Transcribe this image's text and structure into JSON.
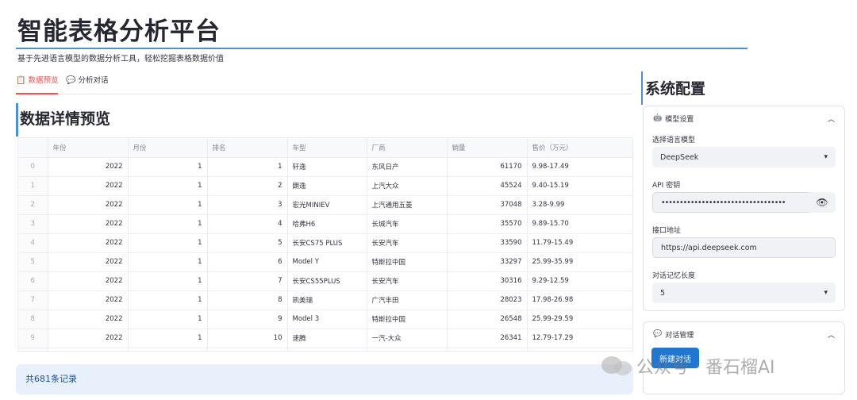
{
  "header": {
    "title": "智能表格分析平台",
    "subtitle": "基于先进语言模型的数据分析工具，轻松挖掘表格数据价值"
  },
  "tabs": [
    {
      "label": "数据预览",
      "icon": "clipboard-icon",
      "active": true
    },
    {
      "label": "分析对话",
      "icon": "chat-bubble-icon",
      "active": false
    }
  ],
  "main": {
    "section_title": "数据详情预览",
    "table": {
      "columns": [
        "",
        "年份",
        "月份",
        "排名",
        "车型",
        "厂商",
        "销量",
        "售价（万元）"
      ],
      "rows": [
        [
          "0",
          "2022",
          "1",
          "1",
          "轩逸",
          "东风日产",
          "61170",
          "9.98-17.49"
        ],
        [
          "1",
          "2022",
          "1",
          "2",
          "朗逸",
          "上汽大众",
          "45524",
          "9.40-15.19"
        ],
        [
          "2",
          "2022",
          "1",
          "3",
          "宏光MINIEV",
          "上汽通用五菱",
          "37048",
          "3.28-9.99"
        ],
        [
          "3",
          "2022",
          "1",
          "4",
          "哈弗H6",
          "长城汽车",
          "35570",
          "9.89-15.70"
        ],
        [
          "4",
          "2022",
          "1",
          "5",
          "长安CS75 PLUS",
          "长安汽车",
          "33590",
          "11.79-15.49"
        ],
        [
          "5",
          "2022",
          "1",
          "6",
          "Model Y",
          "特斯拉中国",
          "33297",
          "25.99-35.99"
        ],
        [
          "6",
          "2022",
          "1",
          "7",
          "长安CS55PLUS",
          "长安汽车",
          "30316",
          "9.29-12.59"
        ],
        [
          "7",
          "2022",
          "1",
          "8",
          "凯美瑞",
          "广汽丰田",
          "28023",
          "17.98-26.98"
        ],
        [
          "8",
          "2022",
          "1",
          "9",
          "Model 3",
          "特斯拉中国",
          "26548",
          "25.99-29.59"
        ],
        [
          "9",
          "2022",
          "1",
          "10",
          "速腾",
          "一汽-大众",
          "26341",
          "12.79-17.29"
        ]
      ]
    },
    "record_count": "共681条记录"
  },
  "sidebar": {
    "title": "系统配置",
    "model_card": {
      "header": "模型设置",
      "icon": "robot-icon",
      "model_label": "选择语言模型",
      "model_value": "DeepSeek",
      "api_key_label": "API 密钥",
      "api_key_value": "••••••••••••••••••••••••••••••••••",
      "endpoint_label": "接口地址",
      "endpoint_value": "https://api.deepseek.com",
      "memory_label": "对话记忆长度",
      "memory_value": "5"
    },
    "chat_card": {
      "header": "对话管理",
      "icon": "chat-bubble-icon",
      "new_chat_label": "新建对话"
    }
  },
  "watermark": "公众号 · 番石榴AI",
  "colors": {
    "accent_blue": "#4a90d9",
    "tab_active": "#ff4b4b",
    "button_blue": "#1f77d0",
    "info_bg": "#e8f1fb"
  }
}
